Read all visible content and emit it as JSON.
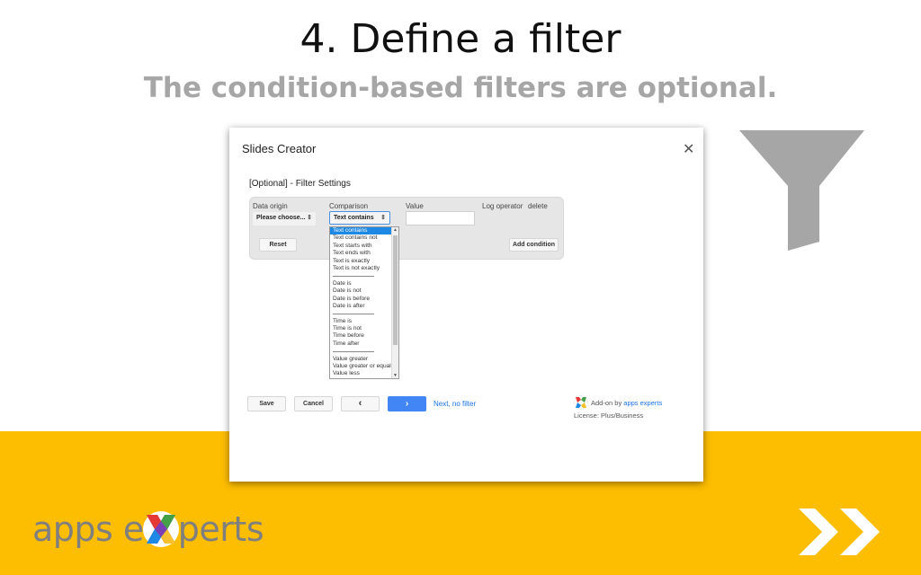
{
  "slide": {
    "title": "4. Define a filter",
    "subtitle": "The condition-based filters are optional."
  },
  "dialog": {
    "title": "Slides Creator",
    "close_icon": "close-icon",
    "section_title": "[Optional] - Filter Settings",
    "columns": {
      "data_origin": "Data origin",
      "comparison": "Comparison",
      "value": "Value",
      "log_operator": "Log  operator",
      "delete": "delete"
    },
    "data_origin_selected": "Please choose...",
    "comparison_selected": "Text contains",
    "value_input": "",
    "reset_label": "Reset",
    "add_condition_label": "Add condition",
    "dropdown_options": [
      "Text contains",
      "Text contains not",
      "Text starts with",
      "Text ends with",
      "Text is exactly",
      "Text is not exactly",
      "---------------",
      "Date is",
      "Date is not",
      "Date is before",
      "Date is after",
      "---------------",
      "Time is",
      "Time is not",
      "Time before",
      "Time after",
      "---------------",
      "Value greater",
      "Value greater or equal",
      "Value less"
    ],
    "footer": {
      "save_label": "Save",
      "cancel_label": "Cancel",
      "prev_icon": "chevron-left-icon",
      "next_icon": "chevron-right-icon",
      "next_no_filter_label": "Next, no filter",
      "addon_prefix": "Add-on by ",
      "addon_link": "apps experts",
      "license": "License: Plus/Business"
    }
  },
  "branding": {
    "logo_left": "apps e",
    "logo_right": "perts"
  },
  "colors": {
    "accent_yellow": "#fdbd00",
    "primary_blue": "#4285f4",
    "funnel_gray": "#a6a6a6"
  }
}
